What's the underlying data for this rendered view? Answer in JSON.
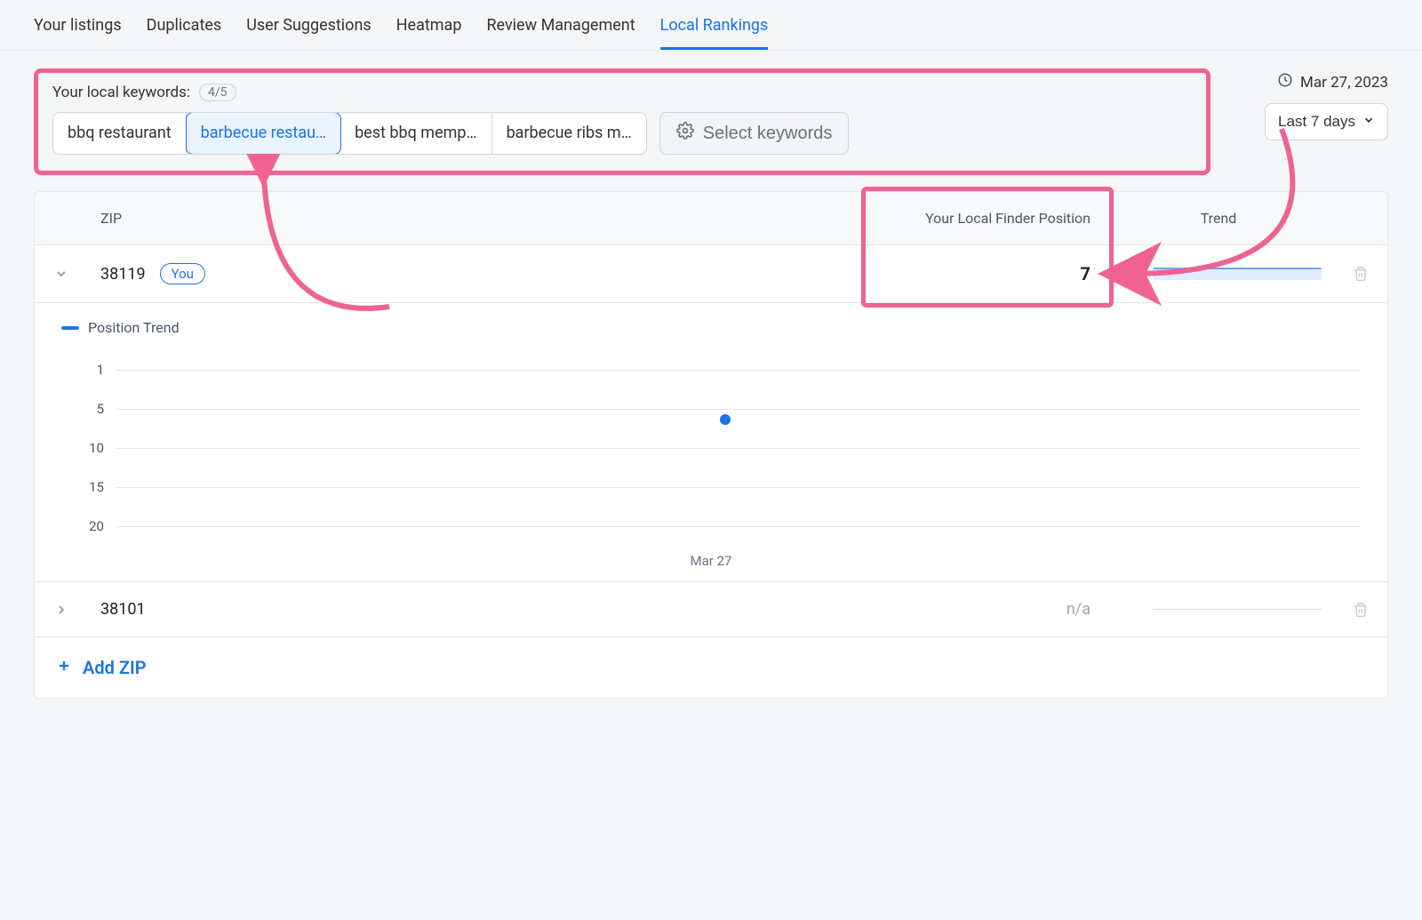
{
  "tabs": {
    "items": [
      "Your listings",
      "Duplicates",
      "User Suggestions",
      "Heatmap",
      "Review Management",
      "Local Rankings"
    ],
    "active_index": 5
  },
  "keywords": {
    "title": "Your local keywords:",
    "count_label": "4/5",
    "items": [
      "bbq restaurant",
      "barbecue restau…",
      "best bbq memp…",
      "barbecue ribs m…"
    ],
    "selected_index": 1,
    "select_button": "Select keywords"
  },
  "date": {
    "label": "Mar 27, 2023",
    "range": "Last 7 days"
  },
  "table": {
    "headers": {
      "zip": "ZIP",
      "position": "Your Local Finder Position",
      "trend": "Trend"
    },
    "rows": [
      {
        "expanded": true,
        "zip": "38119",
        "you": "You",
        "position": "7",
        "has_trend": true,
        "has_chart": true
      },
      {
        "expanded": false,
        "zip": "38101",
        "you": "",
        "position": "n/a",
        "has_trend": false,
        "has_chart": false
      }
    ],
    "add_label": "Add ZIP"
  },
  "chart_data": {
    "type": "scatter",
    "title": "Position Trend",
    "x": [
      "Mar 27"
    ],
    "series": [
      {
        "name": "Position Trend",
        "values": [
          7
        ]
      }
    ],
    "ylabel": "",
    "xlabel": "",
    "y_ticks": [
      1,
      5,
      10,
      15,
      20
    ],
    "ylim": [
      1,
      20
    ],
    "y_inverted": true
  }
}
